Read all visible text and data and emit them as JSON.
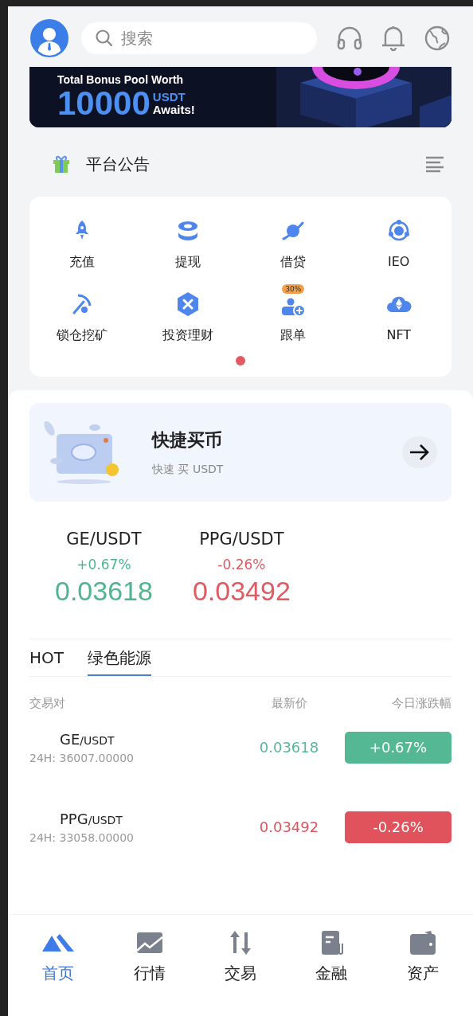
{
  "header": {
    "search": {
      "placeholder": "搜索"
    }
  },
  "banner": {
    "line1": "Total Bonus Pool Worth",
    "amount": "10000",
    "unit": "USDT",
    "tail": "Awaits!"
  },
  "announcement": {
    "title": "平台公告"
  },
  "shortcuts": [
    {
      "kind": "rocket",
      "label": "充值"
    },
    {
      "kind": "coins",
      "label": "提现"
    },
    {
      "kind": "planet",
      "label": "借贷"
    },
    {
      "kind": "orbit",
      "label": "IEO"
    },
    {
      "kind": "pickaxe",
      "label": "锁仓挖矿"
    },
    {
      "kind": "hexagon",
      "label": "投资理财"
    },
    {
      "kind": "follow",
      "label": "跟单",
      "badge": "30%"
    },
    {
      "kind": "cloud",
      "label": "NFT"
    }
  ],
  "pager": [
    {
      "selected": true
    }
  ],
  "quick_buy": {
    "title": "快捷买币",
    "subtitle": "快速 买 USDT"
  },
  "tickers": [
    {
      "pair": "GE/USDT",
      "change": "+0.67%",
      "price": "0.03618",
      "color": "#4fb58f"
    },
    {
      "pair": "PPG/USDT",
      "change": "-0.26%",
      "price": "0.03492",
      "color": "#e05a62"
    }
  ],
  "tabs": [
    {
      "label": "HOT",
      "selected": false
    },
    {
      "label": "绿色能源",
      "selected": true
    }
  ],
  "table": {
    "columns": [
      "交易对",
      "最新价",
      "今日涨跌幅"
    ],
    "rows": [
      {
        "base": "GE",
        "quote": "/USDT",
        "volume": "24H: 36007.00000",
        "price": "0.03618",
        "change": "+0.67%",
        "color": "#55b894"
      },
      {
        "base": "PPG",
        "quote": "/USDT",
        "volume": "24H: 33058.00000",
        "price": "0.03492",
        "change": "-0.26%",
        "color": "#e0535c"
      }
    ]
  },
  "nav": [
    {
      "kind": "home",
      "label": "首页",
      "selected": true
    },
    {
      "kind": "chart",
      "label": "行情",
      "selected": false
    },
    {
      "kind": "trade",
      "label": "交易",
      "selected": false
    },
    {
      "kind": "finance",
      "label": "金融",
      "selected": false
    },
    {
      "kind": "wallet",
      "label": "资产",
      "selected": false
    }
  ]
}
